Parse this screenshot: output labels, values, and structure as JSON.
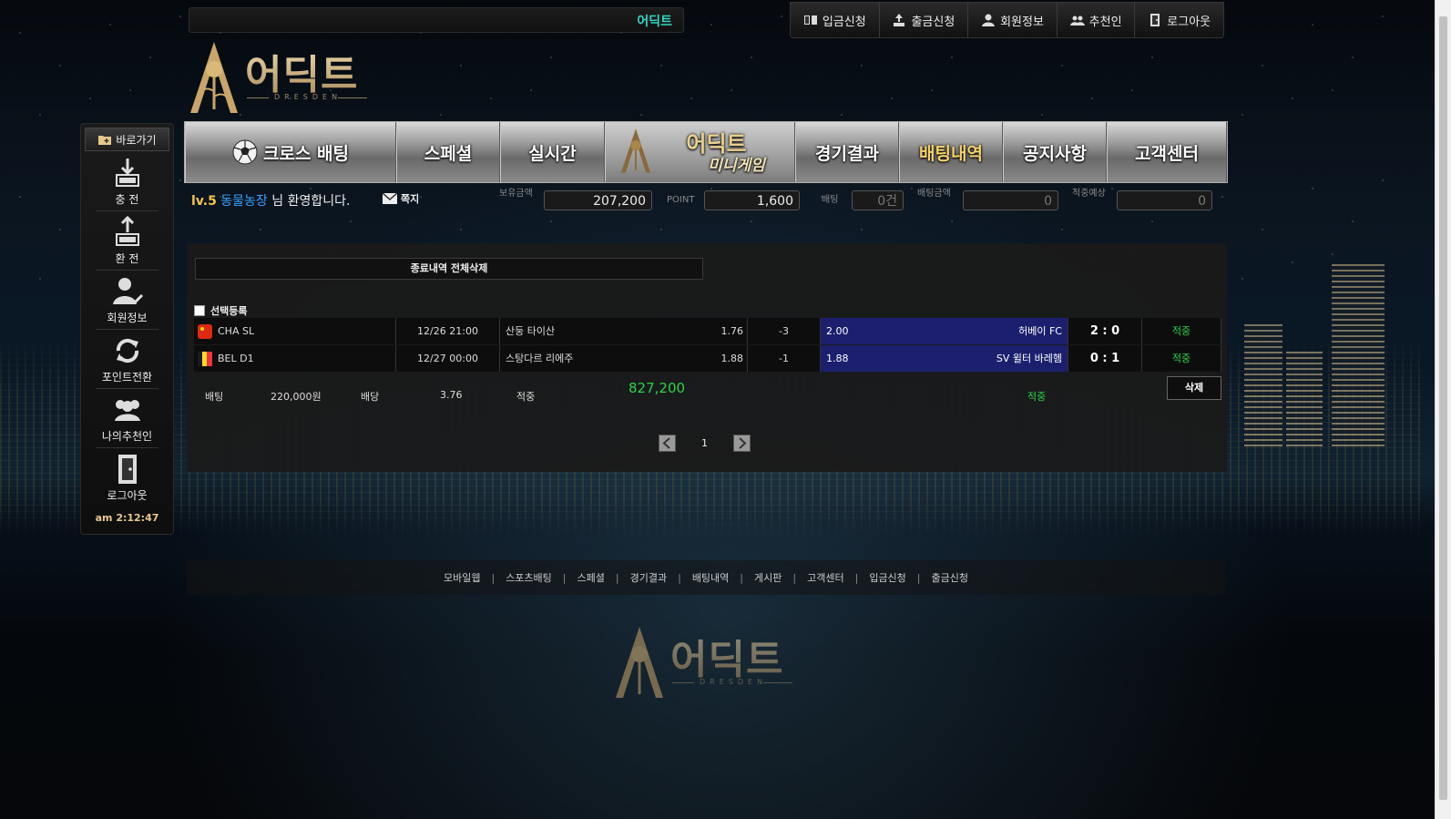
{
  "site": {
    "name": "어딕트",
    "logo_text": "어딕트",
    "logo_sub": "DRESDEN"
  },
  "top_menu": [
    {
      "label": "입금신청",
      "icon": "deposit-icon"
    },
    {
      "label": "출금신청",
      "icon": "withdraw-icon"
    },
    {
      "label": "회원정보",
      "icon": "user-icon"
    },
    {
      "label": "추천인",
      "icon": "users-icon"
    },
    {
      "label": "로그아웃",
      "icon": "door-icon"
    }
  ],
  "quick_menu": {
    "title": "바로가기",
    "items": [
      {
        "label": "충 전",
        "icon": "charge-icon"
      },
      {
        "label": "환 전",
        "icon": "exchange-icon"
      },
      {
        "label": "회원정보",
        "icon": "member-icon"
      },
      {
        "label": "포인트전환",
        "icon": "refresh-icon"
      },
      {
        "label": "나의추천인",
        "icon": "group-icon"
      },
      {
        "label": "로그아웃",
        "icon": "logout-icon"
      }
    ],
    "clock": "am 2:12:47"
  },
  "main_nav": [
    {
      "label": "크로스 배팅"
    },
    {
      "label": "스페셜"
    },
    {
      "label": "실시간"
    },
    {
      "label": "어딕트",
      "sub": "미니게임"
    },
    {
      "label": "경기결과"
    },
    {
      "label": "배팅내역"
    },
    {
      "label": "공지사항"
    },
    {
      "label": "고객센터"
    }
  ],
  "user": {
    "level": "lv.5",
    "nickname": "동물농장",
    "welcome_suffix": "님 환영합니다.",
    "note_label": "쪽지",
    "balance_label": "보유금액",
    "balance": "207,200",
    "point_label": "POINT",
    "point": "1,600",
    "bet_count_label": "배팅",
    "bet_count": "0건",
    "bet_amount_label": "배팅금액",
    "bet_amount": "0",
    "expected_label": "적중예상",
    "expected": "0"
  },
  "history": {
    "delete_all_label": "종료내역 전체삭제",
    "select_label": "선택등록",
    "rows": [
      {
        "league": "CHA SL",
        "time": "12/26 21:00",
        "home": "산둥 타이산",
        "home_odds": "1.76",
        "handicap": "-3",
        "away_odds": "2.00",
        "away": "허베이 FC",
        "score": "2 : 0",
        "result": "적중",
        "flag": "china"
      },
      {
        "league": "BEL D1",
        "time": "12/27 00:00",
        "home": "스탕다르 리에주",
        "home_odds": "1.88",
        "handicap": "-1",
        "away_odds": "1.88",
        "away": "SV 윌터 바레헴",
        "score": "0 : 1",
        "result": "적중",
        "flag": "belgium"
      }
    ],
    "summary": {
      "bet_label": "배팅",
      "bet_amount": "220,000원",
      "odds_label": "배당",
      "odds": "3.76",
      "win_label": "적중",
      "win_amount": "827,200",
      "result": "적중"
    },
    "delete_label": "삭제",
    "page": "1"
  },
  "footer_links": [
    "모바일웹",
    "스포츠배팅",
    "스페셜",
    "경기결과",
    "배팅내역",
    "게시판",
    "고객센터",
    "입금신청",
    "출금신청"
  ],
  "colors": {
    "accent_teal": "#2fd6c0",
    "win_green": "#2bd24b",
    "gold": "#f6d36a",
    "away_highlight": "#1b1f6e",
    "nick_blue": "#3aa3ff"
  }
}
